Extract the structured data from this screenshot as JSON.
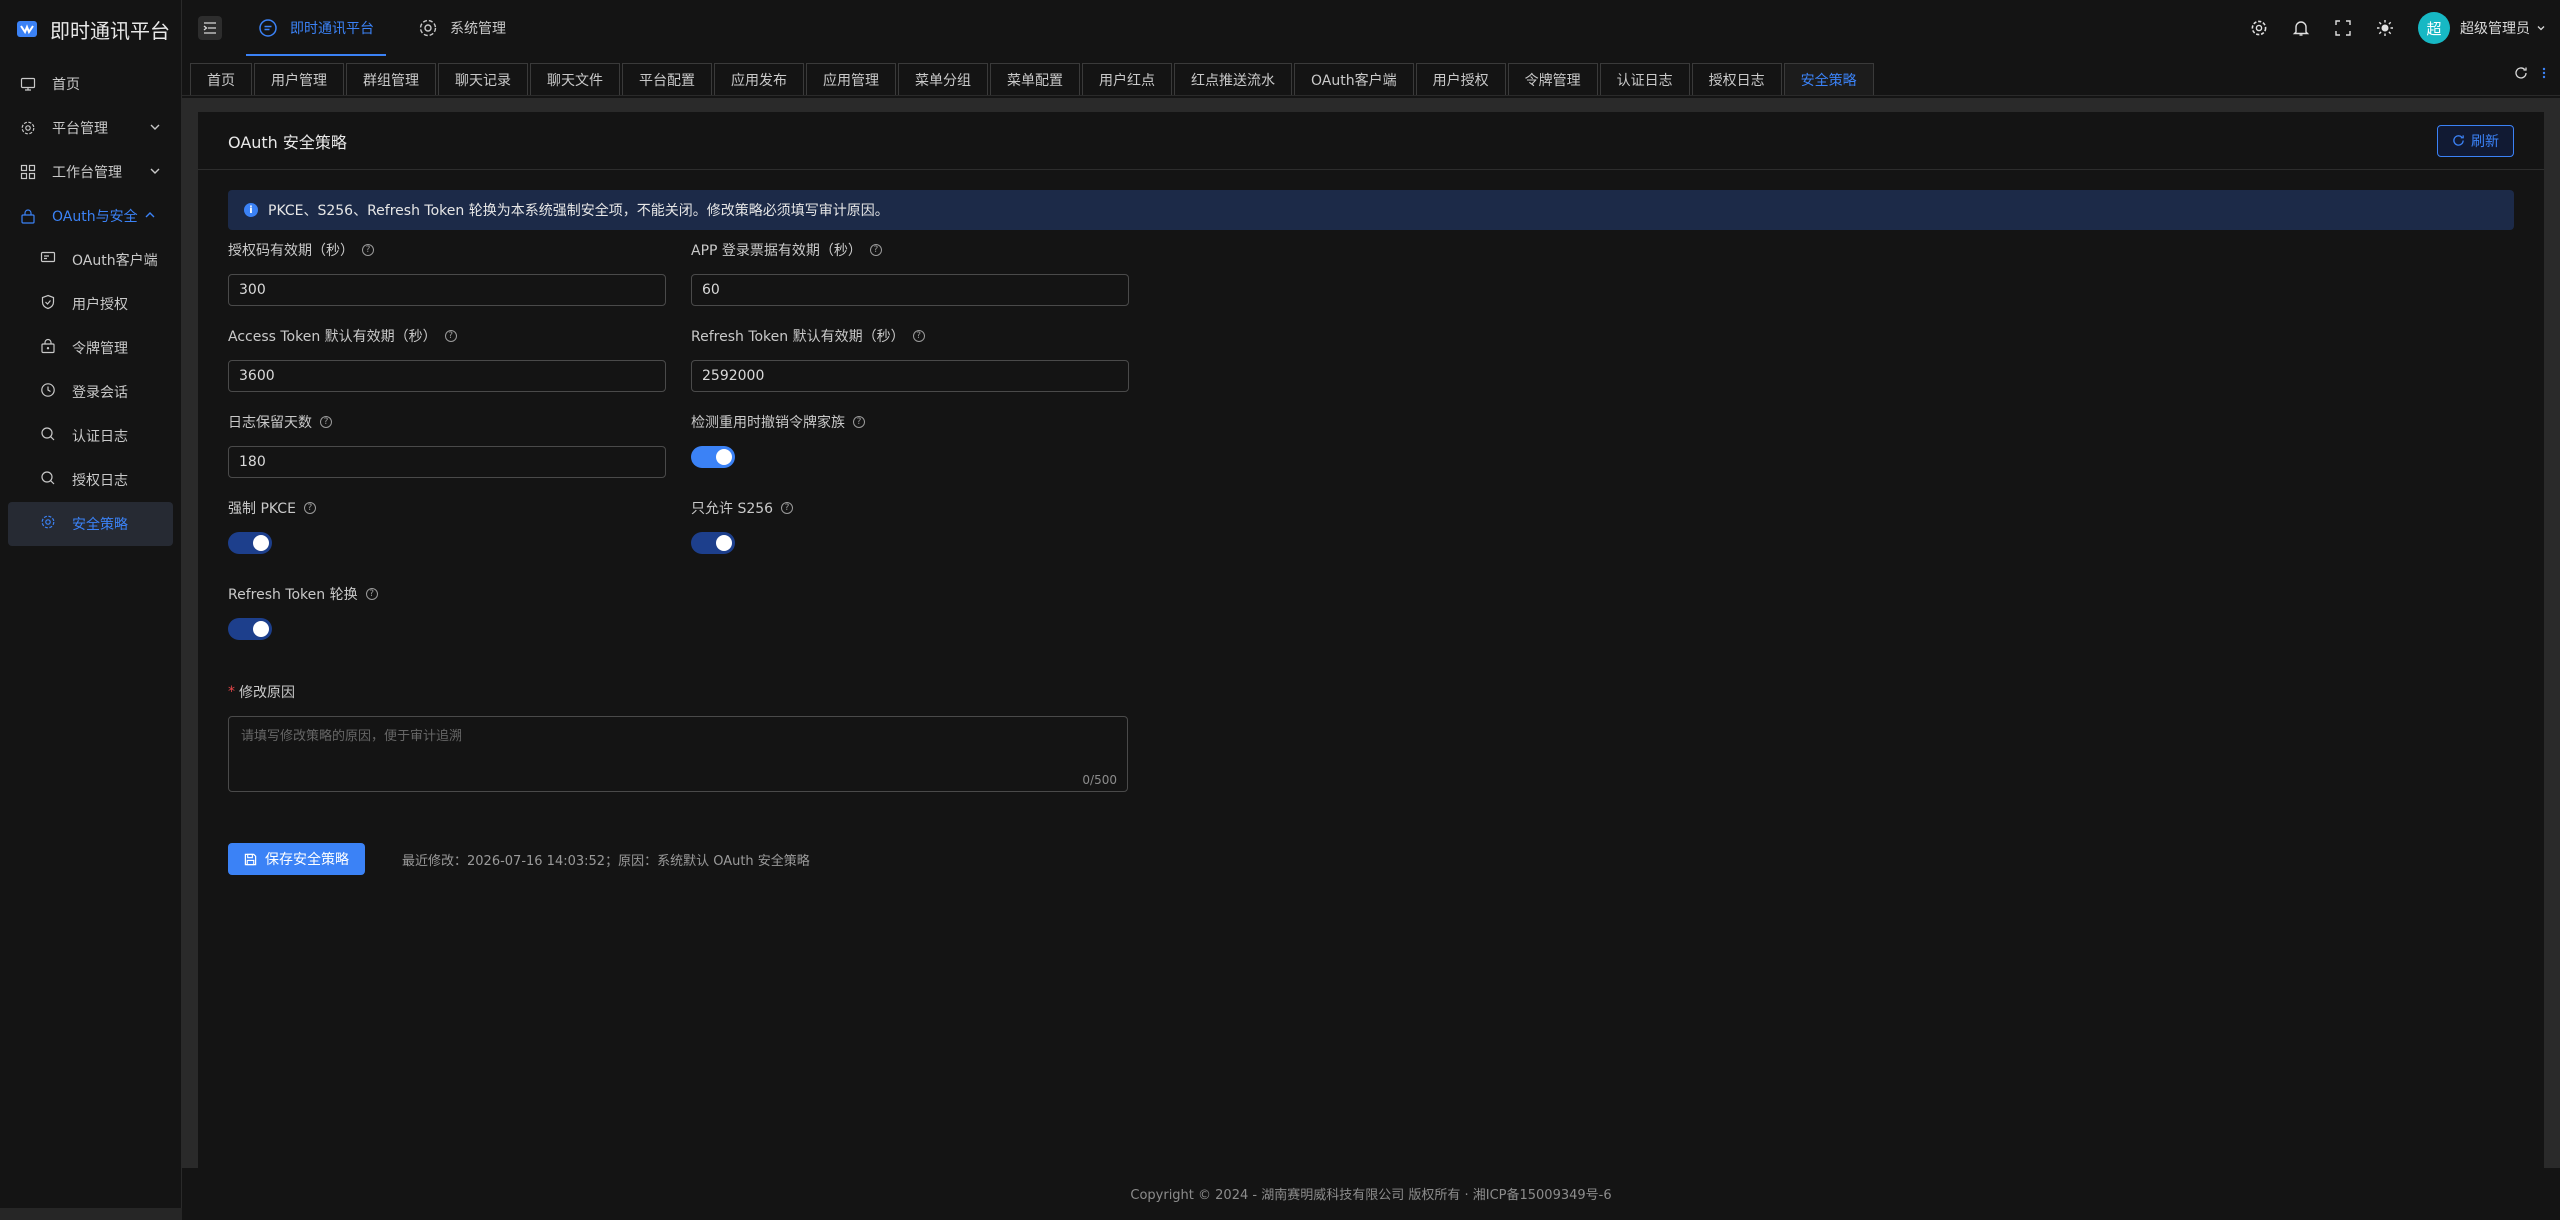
{
  "app": {
    "title": "即时通讯平台"
  },
  "sidebar": {
    "items": [
      {
        "label": "首页",
        "icon": "monitor-icon"
      },
      {
        "label": "平台管理",
        "icon": "gear-icon"
      },
      {
        "label": "工作台管理",
        "icon": "grid-icon"
      },
      {
        "label": "OAuth与安全",
        "icon": "lock-icon"
      }
    ],
    "sub_items": [
      {
        "label": "OAuth客户端",
        "icon": "client-icon"
      },
      {
        "label": "用户授权",
        "icon": "shield-icon"
      },
      {
        "label": "令牌管理",
        "icon": "token-icon"
      },
      {
        "label": "登录会话",
        "icon": "clock-icon"
      },
      {
        "label": "认证日志",
        "icon": "search-icon"
      },
      {
        "label": "授权日志",
        "icon": "search-icon"
      },
      {
        "label": "安全策略",
        "icon": "gear-icon"
      }
    ]
  },
  "header": {
    "tabs": [
      {
        "label": "即时通讯平台"
      },
      {
        "label": "系统管理"
      }
    ],
    "user_name": "超级管理员",
    "avatar_char": "超"
  },
  "page_tabs": [
    "首页",
    "用户管理",
    "群组管理",
    "聊天记录",
    "聊天文件",
    "平台配置",
    "应用发布",
    "应用管理",
    "菜单分组",
    "菜单配置",
    "用户红点",
    "红点推送流水",
    "OAuth客户端",
    "用户授权",
    "令牌管理",
    "认证日志",
    "授权日志",
    "安全策略"
  ],
  "main": {
    "title": "OAuth 安全策略",
    "refresh_label": "刷新",
    "alert": "PKCE、S256、Refresh Token 轮换为本系统强制安全项，不能关闭。修改策略必须填写审计原因。",
    "fields": {
      "auth_code_ttl": {
        "label": "授权码有效期（秒）",
        "value": "300"
      },
      "app_ticket_ttl": {
        "label": "APP 登录票据有效期（秒）",
        "value": "60"
      },
      "access_token_ttl": {
        "label": "Access Token 默认有效期（秒）",
        "value": "3600"
      },
      "refresh_token_ttl": {
        "label": "Refresh Token 默认有效期（秒）",
        "value": "2592000"
      },
      "log_retention": {
        "label": "日志保留天数",
        "value": "180"
      },
      "revoke_family": {
        "label": "检测重用时撤销令牌家族",
        "on": true
      },
      "force_pkce": {
        "label": "强制 PKCE",
        "on": true
      },
      "s256_only": {
        "label": "只允许 S256",
        "on": true
      },
      "rotate_refresh": {
        "label": "Refresh Token 轮换",
        "on": true
      }
    },
    "reason": {
      "label": "修改原因",
      "required_mark": "*",
      "placeholder": "请填写修改策略的原因，便于审计追溯",
      "counter": "0/500"
    },
    "save_label": "保存安全策略",
    "last_modified": "最近修改：2026-07-16 14:03:52；原因：系统默认 OAuth 安全策略"
  },
  "footer": "Copyright © 2024 - 湖南赛明威科技有限公司 版权所有 · 湘ICP备15009349号-6"
}
